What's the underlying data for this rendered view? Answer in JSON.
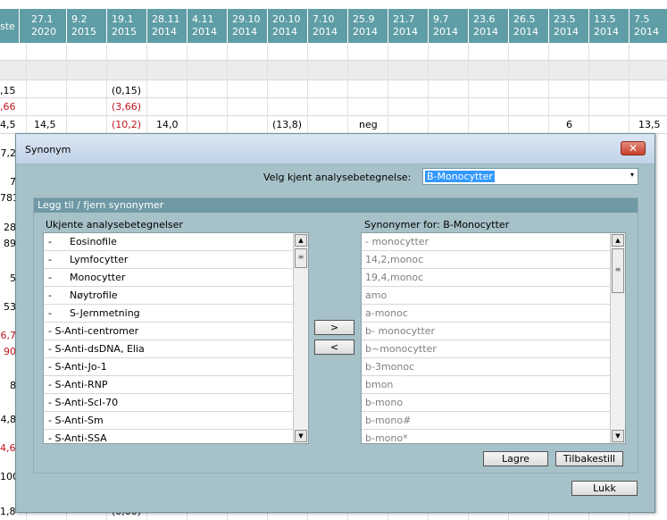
{
  "grid": {
    "edge_header": "ste",
    "columns": [
      {
        "d": "27.1",
        "y": "2020"
      },
      {
        "d": "9.2",
        "y": "2015"
      },
      {
        "d": "19.1",
        "y": "2015"
      },
      {
        "d": "28.11",
        "y": "2014"
      },
      {
        "d": "4.11",
        "y": "2014"
      },
      {
        "d": "29.10",
        "y": "2014"
      },
      {
        "d": "20.10",
        "y": "2014"
      },
      {
        "d": "7.10",
        "y": "2014"
      },
      {
        "d": "25.9",
        "y": "2014"
      },
      {
        "d": "21.7",
        "y": "2014"
      },
      {
        "d": "9.7",
        "y": "2014"
      },
      {
        "d": "23.6",
        "y": "2014"
      },
      {
        "d": "26.5",
        "y": "2014"
      },
      {
        "d": "23.5",
        "y": "2014"
      },
      {
        "d": "13.5",
        "y": "2014"
      },
      {
        "d": "7.5",
        "y": "2014"
      }
    ],
    "row1": {
      "edge": ",15",
      "c2": "(0,15)"
    },
    "row2": {
      "edge": ",66",
      "c2": "(3,66)"
    },
    "row3": {
      "edge": "4,5",
      "c0": "14,5",
      "c2": "(10,2)",
      "c3": "14,0",
      "c6": "(13,8)",
      "c8": "neg",
      "c13": "6",
      "c15": "13,5"
    },
    "left_edge": [
      "7,2",
      "7",
      "781",
      "28",
      "89",
      "5",
      "53",
      "6,7",
      "90",
      "8",
      "4,8",
      "4,60",
      "100",
      "1,83"
    ],
    "bottom_partial": "(0,00)"
  },
  "dialog": {
    "title": "Synonym",
    "close_glyph": "✕",
    "select_label": "Velg kjent analysebetegnelse:",
    "select_value": "B-Monocytter",
    "select_arrow": "▾",
    "group_title": "Legg til / fjern synonymer",
    "left_header": "Ukjente analysebetegnelser",
    "right_header": "Synonymer for: B-Monocytter",
    "left_items": [
      {
        "dash": "-",
        "text": "Eosinofile"
      },
      {
        "dash": "-",
        "text": "Lymfocytter"
      },
      {
        "dash": "-",
        "text": "Monocytter"
      },
      {
        "dash": "-",
        "text": "Nøytrofile"
      },
      {
        "dash": "-",
        "text": "S-Jernmetning"
      },
      {
        "dash": "",
        "text": "- S-Anti-centromer"
      },
      {
        "dash": "",
        "text": "- S-Anti-dsDNA, Elia"
      },
      {
        "dash": "",
        "text": "- S-Anti-Jo-1"
      },
      {
        "dash": "",
        "text": "- S-Anti-RNP"
      },
      {
        "dash": "",
        "text": "- S-Anti-Scl-70"
      },
      {
        "dash": "",
        "text": "- S-Anti-Sm"
      },
      {
        "dash": "",
        "text": "- S-Anti-SSA"
      }
    ],
    "right_items": [
      "- monocytter",
      "14,2,monoc",
      "19,4,monoc",
      "amo",
      "a-monoc",
      "b- monocytter",
      "b~monocytter",
      "b-3monoc",
      "bmon",
      "b-mono",
      "b-mono#",
      "b-mono*"
    ],
    "add_button": ">",
    "remove_button": "<",
    "save_button": "Lagre",
    "reset_button": "Tilbakestill",
    "close_button": "Lukk",
    "scroll_up": "▲",
    "scroll_down": "▼",
    "thumb_grip": "≡"
  }
}
